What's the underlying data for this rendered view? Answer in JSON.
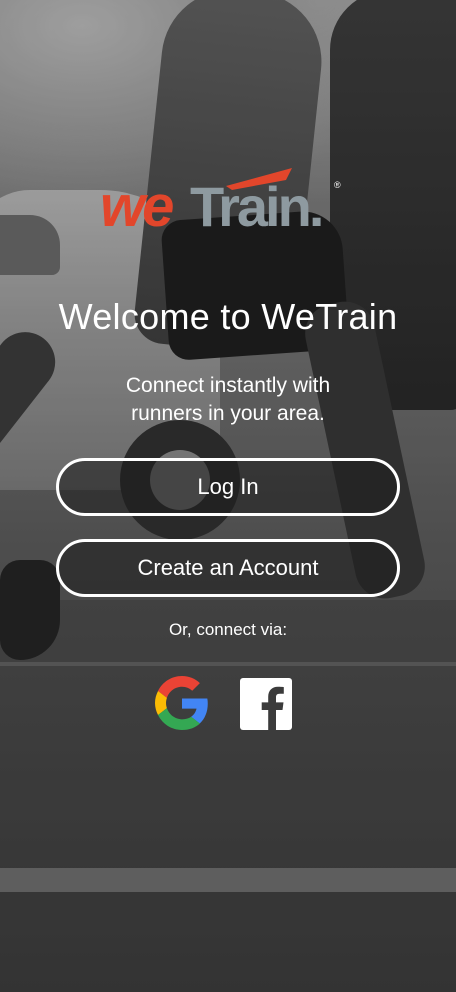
{
  "brand": {
    "logo_left": "we",
    "logo_right": "Train.",
    "logo_mark": "®",
    "colors": {
      "orange": "#e2462b",
      "gray": "#8e9aa0"
    }
  },
  "welcome": {
    "title": "Welcome to WeTrain",
    "subtitle_line1": "Connect instantly with",
    "subtitle_line2": "runners in your area."
  },
  "actions": {
    "login_label": "Log In",
    "create_label": "Create an Account"
  },
  "social": {
    "prompt": "Or, connect via:",
    "providers": [
      {
        "name": "Google",
        "icon": "google-icon"
      },
      {
        "name": "Facebook",
        "icon": "facebook-icon"
      }
    ]
  }
}
